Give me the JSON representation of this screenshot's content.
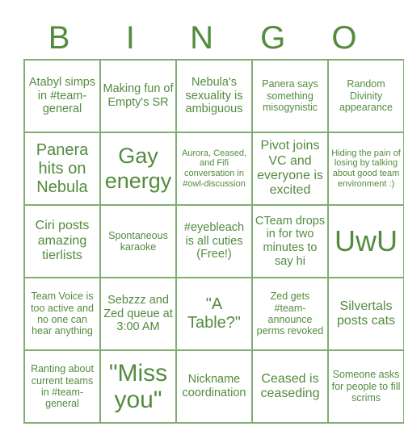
{
  "header": {
    "letters": [
      "B",
      "I",
      "N",
      "G",
      "O"
    ]
  },
  "board": {
    "rows": [
      [
        "Atabyl simps in #team-general",
        "Making fun of Empty's SR",
        "Nebula's sexuality is ambiguous",
        "Panera says something misogynistic",
        "Random Divinity appearance"
      ],
      [
        "Panera hits on Nebula",
        "Gay energy",
        "Aurora, Ceased, and Fifi conversation in #owl-discussion",
        "Pivot joins VC and everyone is excited",
        "Hiding the pain of losing by talking about good team environment :)"
      ],
      [
        "Ciri posts amazing tierlists",
        "Spontaneous karaoke",
        "#eyebleach is all cuties (Free!)",
        "CTeam drops in for two minutes to say hi",
        "UwU"
      ],
      [
        "Team Voice is too active and no one can hear anything",
        "Sebzzz and Zed queue at 3:00 AM",
        "\"A Table?\"",
        "Zed gets #team-announce perms revoked",
        "Silvertals posts cats"
      ],
      [
        "Ranting about current teams in #team-general",
        "\"Miss you\"",
        "Nickname coordination",
        "Ceased is ceaseding",
        "Someone asks for people to fill scrims"
      ]
    ]
  },
  "colors": {
    "text": "#538b3f",
    "grid": "#80ad72",
    "background": "#ffffff"
  }
}
